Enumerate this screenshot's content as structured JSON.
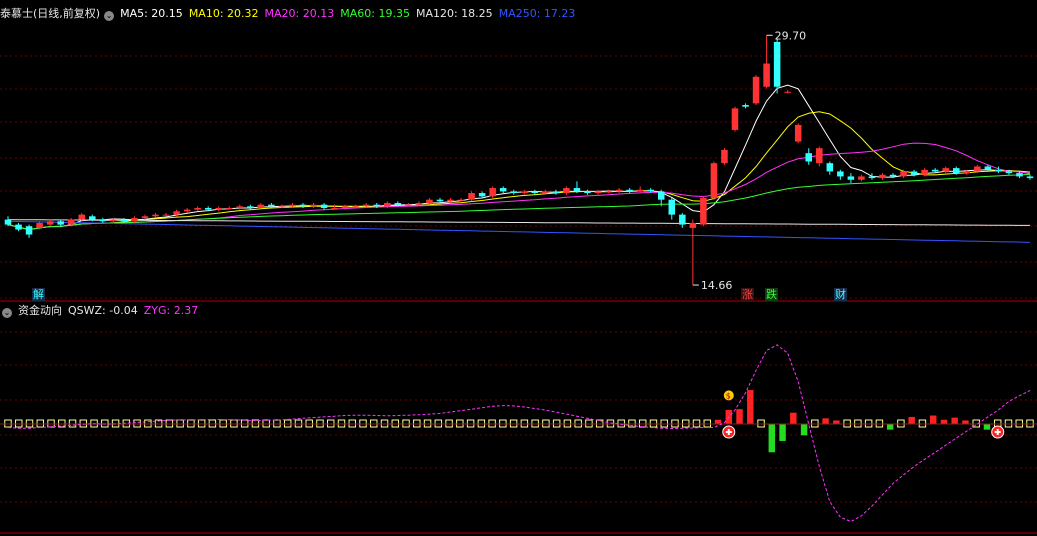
{
  "main_header": {
    "title": "泰慕士(日线,前复权)",
    "ma5": "MA5: 20.15",
    "ma10": "MA10: 20.32",
    "ma20": "MA20: 20.13",
    "ma60": "MA60: 19.35",
    "ma120": "MA120: 18.25",
    "ma250": "MA250: 17.23",
    "colors": {
      "title": "#e6e6e6",
      "ma5": "#ffffff",
      "ma10": "#ffff00",
      "ma20": "#ff33ff",
      "ma60": "#33ff33",
      "ma120": "#e6e6e6",
      "ma250": "#3355ff"
    }
  },
  "sub_header": {
    "title": "资金动向",
    "qswz": "QSWZ: -0.04",
    "zyg": "ZYG: 2.37",
    "colors": {
      "title": "#e6e6e6",
      "qswz": "#e6e6e6",
      "zyg": "#ff33ff"
    }
  },
  "markers": {
    "jie": "解",
    "zhang": "涨",
    "die": "跌",
    "cai": "财"
  },
  "chart_data": [
    {
      "type": "candlestick",
      "high_label": "29.70",
      "low_label": "14.66",
      "candles": [
        [
          18.6,
          18.3,
          18.8,
          18.2
        ],
        [
          18.3,
          18.0,
          18.4,
          17.9
        ],
        [
          18.2,
          17.7,
          18.3,
          17.5
        ],
        [
          18.1,
          18.4,
          18.5,
          18.0
        ],
        [
          18.3,
          18.5,
          18.6,
          18.2
        ],
        [
          18.5,
          18.3,
          18.6,
          18.2
        ],
        [
          18.3,
          18.6,
          18.7,
          18.2
        ],
        [
          18.6,
          18.9,
          19.0,
          18.5
        ],
        [
          18.8,
          18.6,
          18.9,
          18.5
        ],
        [
          18.6,
          18.5,
          18.7,
          18.4
        ],
        [
          18.5,
          18.6,
          18.7,
          18.4
        ],
        [
          18.6,
          18.5,
          18.7,
          18.4
        ],
        [
          18.5,
          18.7,
          18.8,
          18.4
        ],
        [
          18.7,
          18.8,
          18.9,
          18.6
        ],
        [
          18.8,
          18.9,
          19.0,
          18.7
        ],
        [
          18.9,
          18.9,
          19.0,
          18.8
        ],
        [
          18.9,
          19.1,
          19.2,
          18.8
        ],
        [
          19.1,
          19.2,
          19.3,
          19.0
        ],
        [
          19.2,
          19.3,
          19.4,
          19.1
        ],
        [
          19.3,
          19.2,
          19.4,
          19.1
        ],
        [
          19.2,
          19.3,
          19.4,
          19.1
        ],
        [
          19.3,
          19.3,
          19.4,
          19.2
        ],
        [
          19.3,
          19.4,
          19.5,
          19.2
        ],
        [
          19.4,
          19.3,
          19.5,
          19.2
        ],
        [
          19.3,
          19.5,
          19.6,
          19.3
        ],
        [
          19.5,
          19.4,
          19.6,
          19.3
        ],
        [
          19.4,
          19.4,
          19.5,
          19.3
        ],
        [
          19.4,
          19.5,
          19.6,
          19.3
        ],
        [
          19.5,
          19.4,
          19.6,
          19.3
        ],
        [
          19.4,
          19.5,
          19.6,
          19.3
        ],
        [
          19.5,
          19.3,
          19.6,
          19.2
        ],
        [
          19.3,
          19.3,
          19.5,
          19.2
        ],
        [
          19.3,
          19.4,
          19.5,
          19.2
        ],
        [
          19.4,
          19.4,
          19.5,
          19.3
        ],
        [
          19.4,
          19.5,
          19.6,
          19.3
        ],
        [
          19.5,
          19.4,
          19.6,
          19.3
        ],
        [
          19.4,
          19.6,
          19.7,
          19.3
        ],
        [
          19.6,
          19.5,
          19.7,
          19.4
        ],
        [
          19.5,
          19.5,
          19.6,
          19.4
        ],
        [
          19.5,
          19.6,
          19.7,
          19.4
        ],
        [
          19.6,
          19.8,
          19.9,
          19.5
        ],
        [
          19.8,
          19.7,
          19.9,
          19.6
        ],
        [
          19.7,
          19.8,
          19.9,
          19.6
        ],
        [
          19.8,
          19.8,
          19.9,
          19.7
        ],
        [
          19.8,
          20.2,
          20.3,
          19.7
        ],
        [
          20.2,
          20.0,
          20.3,
          19.9
        ],
        [
          20.0,
          20.5,
          20.6,
          19.9
        ],
        [
          20.5,
          20.3,
          20.6,
          20.2
        ],
        [
          20.3,
          20.2,
          20.4,
          20.1
        ],
        [
          20.2,
          20.3,
          20.4,
          20.1
        ],
        [
          20.3,
          20.2,
          20.4,
          20.1
        ],
        [
          20.2,
          20.3,
          20.4,
          20.1
        ],
        [
          20.3,
          20.2,
          20.4,
          20.1
        ],
        [
          20.2,
          20.5,
          20.6,
          20.1
        ],
        [
          20.5,
          20.3,
          20.9,
          20.2
        ],
        [
          20.3,
          20.2,
          20.4,
          20.1
        ],
        [
          20.2,
          20.3,
          20.4,
          20.1
        ],
        [
          20.3,
          20.3,
          20.4,
          20.2
        ],
        [
          20.3,
          20.4,
          20.5,
          20.2
        ],
        [
          20.4,
          20.3,
          20.5,
          20.2
        ],
        [
          20.3,
          20.4,
          20.6,
          20.2
        ],
        [
          20.4,
          20.3,
          20.5,
          20.2
        ],
        [
          20.3,
          19.8,
          20.4,
          19.4
        ],
        [
          19.8,
          18.9,
          19.9,
          18.6
        ],
        [
          18.9,
          18.3,
          19.0,
          18.1
        ],
        [
          18.1,
          18.4,
          18.6,
          14.66
        ],
        [
          18.3,
          19.9,
          20.0,
          18.2
        ],
        [
          19.9,
          22.0,
          22.1,
          19.8
        ],
        [
          22.0,
          22.8,
          22.9,
          21.9
        ],
        [
          24.0,
          25.3,
          25.4,
          23.9
        ],
        [
          25.5,
          25.4,
          25.6,
          25.3
        ],
        [
          25.6,
          27.2,
          27.3,
          25.5
        ],
        [
          26.6,
          28.0,
          29.7,
          26.5
        ],
        [
          29.3,
          26.6,
          29.5,
          26.2
        ],
        [
          26.3,
          26.3,
          26.4,
          26.2
        ],
        [
          23.3,
          24.3,
          24.4,
          23.2
        ],
        [
          22.6,
          22.1,
          22.9,
          21.9
        ],
        [
          22.0,
          22.9,
          23.0,
          21.8
        ],
        [
          22.0,
          21.5,
          22.1,
          21.3
        ],
        [
          21.5,
          21.2,
          21.6,
          21.0
        ],
        [
          21.2,
          21.0,
          21.4,
          20.8
        ],
        [
          21.0,
          21.2,
          21.3,
          20.9
        ],
        [
          21.2,
          21.1,
          21.4,
          21.0
        ],
        [
          21.1,
          21.3,
          21.4,
          21.0
        ],
        [
          21.3,
          21.2,
          21.4,
          21.1
        ],
        [
          21.2,
          21.5,
          21.6,
          21.1
        ],
        [
          21.5,
          21.3,
          21.6,
          21.2
        ],
        [
          21.3,
          21.6,
          21.7,
          21.2
        ],
        [
          21.6,
          21.5,
          21.7,
          21.4
        ],
        [
          21.5,
          21.7,
          21.8,
          21.4
        ],
        [
          21.7,
          21.4,
          21.8,
          21.3
        ],
        [
          21.4,
          21.5,
          21.6,
          21.3
        ],
        [
          21.5,
          21.8,
          21.9,
          21.4
        ],
        [
          21.8,
          21.6,
          21.9,
          21.5
        ],
        [
          21.6,
          21.5,
          21.8,
          21.4
        ],
        [
          21.5,
          21.4,
          21.6,
          21.3
        ],
        [
          21.4,
          21.2,
          21.5,
          21.1
        ],
        [
          21.2,
          21.1,
          21.3,
          21.0
        ]
      ],
      "ylim": [
        14.0,
        30.5
      ]
    },
    {
      "type": "bar",
      "qswz": [
        0.12,
        0.1,
        0.1,
        0.05,
        0.08,
        0.12,
        0.12,
        -0.06,
        0.05,
        0.1,
        0.04,
        0.1,
        0.1,
        0.05,
        0.12,
        0.04,
        0.08,
        0.1,
        0.12,
        0.1,
        0.12,
        -0.05,
        0.06,
        0.08,
        0.12,
        0.06,
        0.1,
        0.08,
        0.12,
        -0.06,
        0.1,
        0.12,
        0.1,
        0.05,
        0.1,
        0.08,
        0.12,
        0.06,
        0.1,
        0.12,
        0.08,
        -0.05,
        0.06,
        0.1,
        0.12,
        0.06,
        0.08,
        0.1,
        0.04,
        0.1,
        0.12,
        -0.05,
        0.06,
        0.1,
        0.08,
        0.12,
        -0.06,
        0.1,
        0.12,
        0.08,
        0.06,
        -0.08,
        -0.1,
        0.05,
        -0.06,
        0.05,
        0.3,
        1.0,
        1.05,
        2.4,
        0.12,
        -2.0,
        -1.2,
        0.8,
        -0.8,
        0.12,
        0.4,
        0.25,
        0.12,
        0.12,
        0.12,
        0.12,
        -0.4,
        0.12,
        0.5,
        0.1,
        0.6,
        0.3,
        0.45,
        0.25,
        0.12,
        -0.4,
        0.12,
        0.12,
        0.08,
        -0.04
      ],
      "zyg": [
        -0.25,
        -0.3,
        -0.3,
        -0.25,
        -0.2,
        -0.15,
        -0.1,
        -0.02,
        0.02,
        0.0,
        0.0,
        0.05,
        0.1,
        0.15,
        0.2,
        0.25,
        0.28,
        0.3,
        0.3,
        0.32,
        0.32,
        0.3,
        0.28,
        0.25,
        0.25,
        0.28,
        0.3,
        0.35,
        0.4,
        0.45,
        0.5,
        0.55,
        0.6,
        0.62,
        0.62,
        0.6,
        0.58,
        0.6,
        0.62,
        0.65,
        0.7,
        0.75,
        0.85,
        0.95,
        1.05,
        1.15,
        1.25,
        1.3,
        1.28,
        1.2,
        1.1,
        0.98,
        0.85,
        0.7,
        0.55,
        0.4,
        0.25,
        0.1,
        0.0,
        -0.1,
        -0.18,
        -0.25,
        -0.3,
        -0.32,
        -0.3,
        -0.28,
        -0.25,
        -0.25,
        0.1,
        1.0,
        2.2,
        3.8,
        5.2,
        5.6,
        5.0,
        3.0,
        0.0,
        -3.0,
        -5.5,
        -6.6,
        -6.9,
        -6.5,
        -5.8,
        -5.0,
        -4.2,
        -3.6,
        -3.0,
        -2.5,
        -2.0,
        -1.5,
        -1.0,
        -0.5,
        0.0,
        0.5,
        1.0,
        1.6,
        2.0,
        2.37
      ],
      "ylim": [
        -7.5,
        7.5
      ]
    }
  ]
}
